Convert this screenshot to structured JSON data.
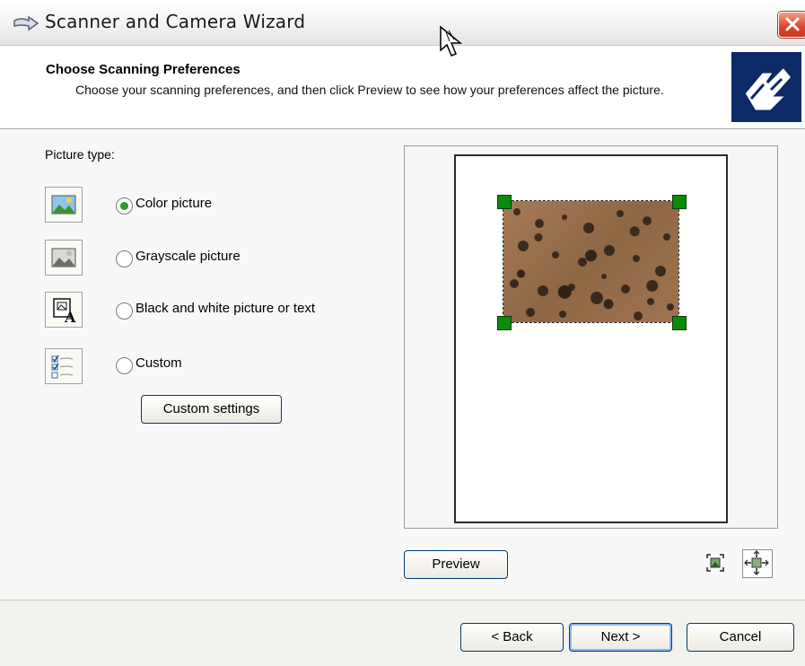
{
  "window": {
    "title": "Scanner and Camera Wizard"
  },
  "header": {
    "title": "Choose Scanning Preferences",
    "description": "Choose your scanning preferences, and then click Preview to see how your preferences affect the picture."
  },
  "picture_type": {
    "label": "Picture type:",
    "options": [
      {
        "label": "Color picture",
        "icon": "color-picture-icon",
        "selected": true
      },
      {
        "label": "Grayscale picture",
        "icon": "grayscale-picture-icon",
        "selected": false
      },
      {
        "label": "Black and white picture or text",
        "icon": "bw-picture-text-icon",
        "selected": false
      },
      {
        "label": "Custom",
        "icon": "custom-checklist-icon",
        "selected": false
      }
    ],
    "custom_settings_label": "Custom settings"
  },
  "preview": {
    "button_label": "Preview"
  },
  "footer": {
    "back_label": "< Back",
    "next_label": "Next >",
    "cancel_label": "Cancel"
  },
  "colors": {
    "selection_handle": "#0a8b0a",
    "radio_selected": "#2a9b2a",
    "logo_bg": "#0c2a67",
    "close_button": "#d9452b"
  }
}
